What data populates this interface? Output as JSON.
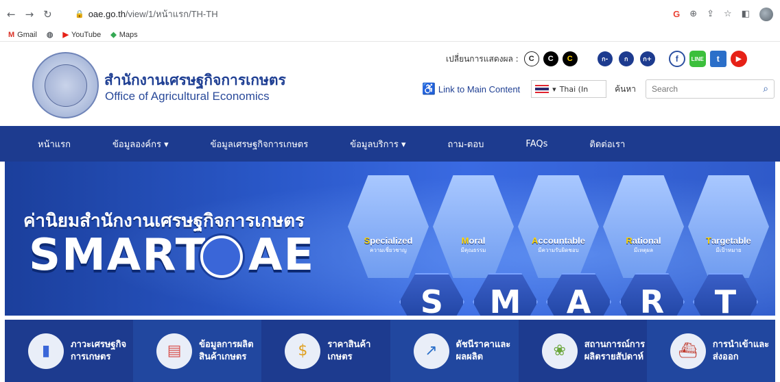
{
  "browser": {
    "url_host": "oae.go.th",
    "url_path": "/view/1/หน้าแรก/TH-TH",
    "bookmarks": [
      {
        "label": "Gmail",
        "icon": "gmail-icon"
      },
      {
        "label": "",
        "icon": "globe-icon"
      },
      {
        "label": "YouTube",
        "icon": "youtube-icon"
      },
      {
        "label": "Maps",
        "icon": "maps-icon"
      }
    ]
  },
  "header": {
    "org_th": "สำนักงานเศรษฐกิจการเกษตร",
    "org_en": "Office of Agricultural Economics",
    "display_label": "เปลี่ยนการแสดงผล :",
    "contrast": [
      "C",
      "C",
      "C"
    ],
    "font_sizes": [
      "ก-",
      "ก",
      "ก+"
    ],
    "skip_link": "Link to Main Content",
    "language": "Thai (In",
    "search_button": "ค้นหา",
    "search_placeholder": "Search"
  },
  "menu": {
    "items": [
      "หน้าแรก",
      "ข้อมูลองค์กร ▾",
      "ข้อมูลเศรษฐกิจการเกษตร",
      "ข้อมูลบริการ ▾",
      "ถาม-ตอบ",
      "FAQs",
      "ติดต่อเรา"
    ]
  },
  "banner": {
    "heading": "ค่านิยมสำนักงานเศรษฐกิจการเกษตร",
    "brand": "SMART",
    "brand_tail": "AE",
    "values": [
      {
        "initial": "S",
        "rest": "pecialized",
        "th": "ความเชี่ยวชาญ"
      },
      {
        "initial": "M",
        "rest": "oral",
        "th": "มีคุณธรรม"
      },
      {
        "initial": "A",
        "rest": "ccountable",
        "th": "มีความรับผิดชอบ"
      },
      {
        "initial": "R",
        "rest": "ational",
        "th": "มีเหตุผล"
      },
      {
        "initial": "T",
        "rest": "argetable",
        "th": "มีเป้าหมาย"
      }
    ],
    "letters": [
      "S",
      "M",
      "A",
      "R",
      "T"
    ],
    "active_slide": 3
  },
  "quick_links": [
    {
      "line1": "ภาวะเศรษฐกิจ",
      "line2": "การเกษตร",
      "icon": "bar-chart-icon"
    },
    {
      "line1": "ข้อมูลการผลิต",
      "line2": "สินค้าเกษตร",
      "icon": "report-icon"
    },
    {
      "line1": "ราคาสินค้า",
      "line2": "เกษตร",
      "icon": "money-bag-icon"
    },
    {
      "line1": "ดัชนีราคาและ",
      "line2": "ผลผลิต",
      "icon": "line-chart-icon"
    },
    {
      "line1": "สถานการณ์การ",
      "line2": "ผลิตรายสัปดาห์",
      "icon": "produce-basket-icon"
    },
    {
      "line1": "การนำเข้าและ",
      "line2": "ส่งออก",
      "icon": "cargo-ship-icon"
    }
  ]
}
